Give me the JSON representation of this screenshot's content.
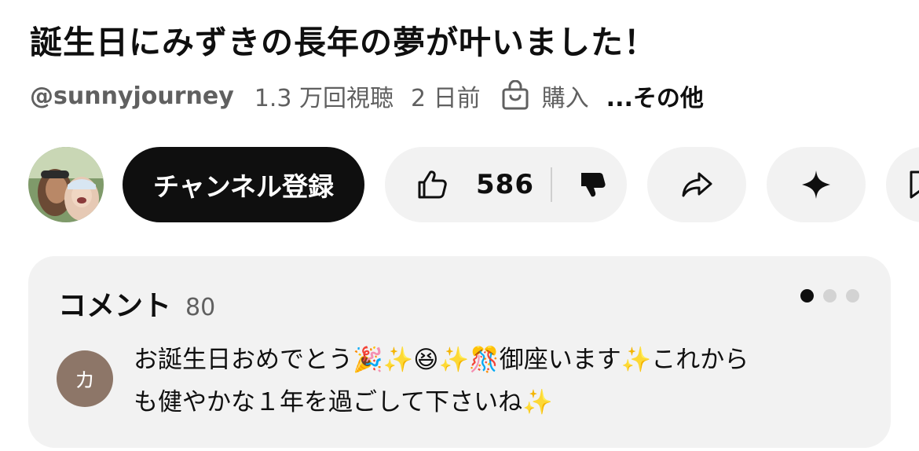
{
  "video": {
    "title": "誕生日にみずきの長年の夢が叶いました！",
    "channel_handle": "@sunnyjourney",
    "views": "1.3 万回視聴",
    "posted": "2 日前",
    "shop_label": "購入",
    "more_label": "...その他"
  },
  "actions": {
    "subscribe_label": "チャンネル登録",
    "like_count": "586",
    "icons": [
      "thumbs-up-icon",
      "thumbs-down-icon",
      "share-icon",
      "sparkle-icon",
      "save-icon",
      "shopping-bag-icon"
    ]
  },
  "comments": {
    "title": "コメント",
    "count": "80",
    "pager": {
      "pages": 3,
      "active": 1
    },
    "first_comment": {
      "avatar_initial": "カ",
      "line1": "お誕生日おめでとう🎉✨😆✨🎊御座います✨これから",
      "line2": "も健やかな１年を過ごして下さいね✨"
    }
  },
  "colors": {
    "subscribe_bg": "#0f0f0f",
    "pill_bg": "#f2f2f2",
    "card_bg": "#f2f2f2",
    "secondary_text": "#606060",
    "commenter_avatar_bg": "#8d7668"
  }
}
